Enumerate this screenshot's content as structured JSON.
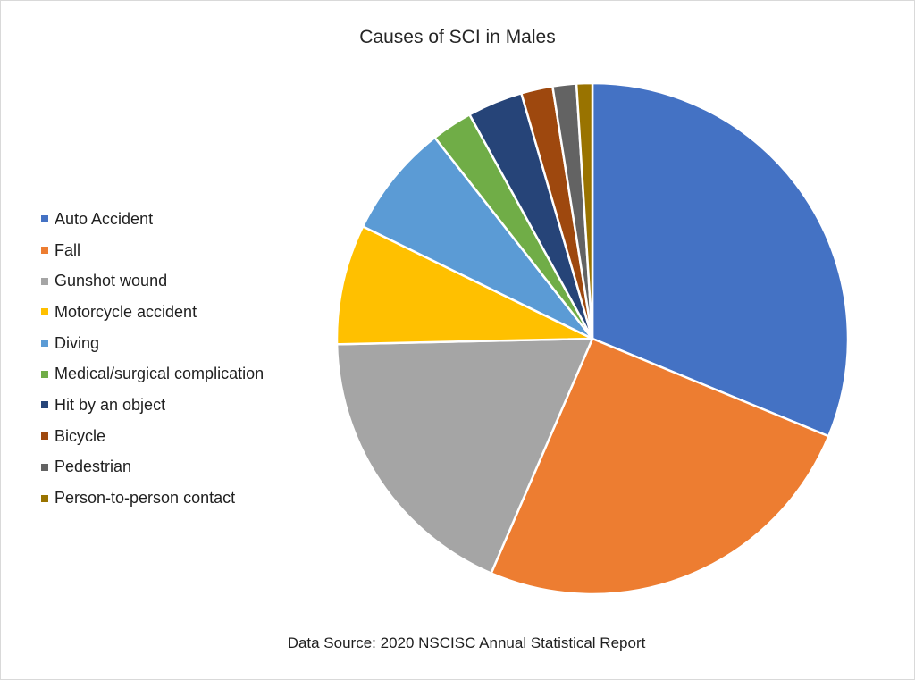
{
  "chart_data": {
    "type": "pie",
    "title": "Causes of SCI in Males",
    "source_note": "Data Source: 2020 NSCISC Annual Statistical Report",
    "legend_position": "left",
    "start_angle": "top, clockwise",
    "categories": [
      "Auto Accident",
      "Fall",
      "Gunshot wound",
      "Motorcycle accident",
      "Diving",
      "Medical/surgical complication",
      "Hit by an object",
      "Bicycle",
      "Pedestrian",
      "Person-to-person contact"
    ],
    "values": [
      31.3,
      25.3,
      18.2,
      7.6,
      7.2,
      2.6,
      3.5,
      2.0,
      1.5,
      1.0
    ],
    "unit": "percent (estimated)",
    "colors": [
      "#4472C4",
      "#ED7D31",
      "#A5A5A5",
      "#FFC000",
      "#5B9BD5",
      "#70AD47",
      "#264478",
      "#9E480E",
      "#636363",
      "#997300"
    ]
  }
}
